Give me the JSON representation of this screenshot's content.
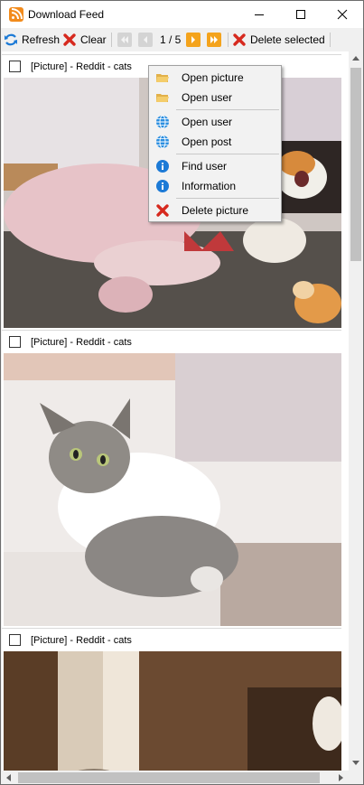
{
  "window": {
    "title": "Download Feed",
    "icon": "rss-feed-icon"
  },
  "toolbar": {
    "refresh_label": "Refresh",
    "clear_label": "Clear",
    "page_indicator": "1 / 5",
    "delete_selected_label": "Delete selected"
  },
  "feed": {
    "items": [
      {
        "caption": "[Picture] - Reddit - cats",
        "checked": false
      },
      {
        "caption": "[Picture] - Reddit - cats",
        "checked": false
      },
      {
        "caption": "[Picture] - Reddit - cats",
        "checked": false
      }
    ]
  },
  "context_menu": {
    "items": [
      {
        "label": "Open picture",
        "icon": "folder-icon"
      },
      {
        "label": "Open user",
        "icon": "folder-icon"
      },
      {
        "label": "Open user",
        "icon": "globe-icon"
      },
      {
        "label": "Open post",
        "icon": "globe-icon"
      },
      {
        "label": "Find user",
        "icon": "info-icon"
      },
      {
        "label": "Information",
        "icon": "info-icon"
      },
      {
        "label": "Delete picture",
        "icon": "delete-icon"
      }
    ]
  },
  "colors": {
    "accent_orange": "#f4a31c",
    "delete_red": "#d6291e",
    "info_blue": "#1c7ad6"
  }
}
